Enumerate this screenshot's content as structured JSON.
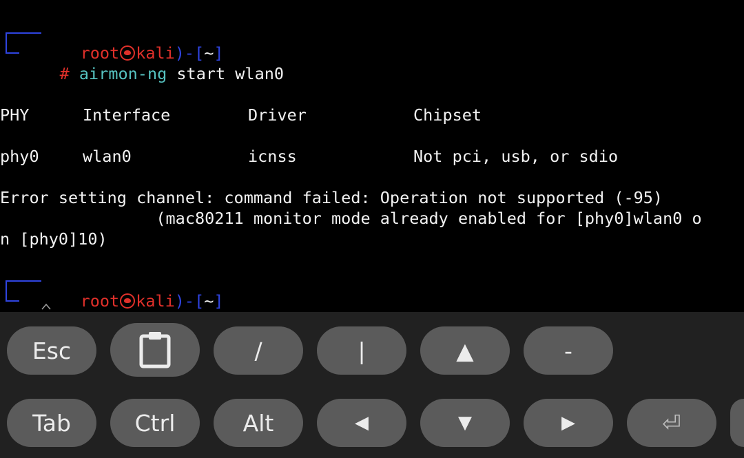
{
  "terminal": {
    "prompt1": {
      "user": "root",
      "host": "kali",
      "dir": "~",
      "hash": "#"
    },
    "command": {
      "program": "airmon-ng",
      "args": " start wlan0"
    },
    "table_headers": {
      "phy": "PHY",
      "interface": "Interface",
      "driver": "Driver",
      "chipset": "Chipset"
    },
    "row": {
      "phy": "phy0",
      "interface": "wlan0",
      "driver": "icnss",
      "chipset": "Not pci, usb, or sdio"
    },
    "error_line1": "Error setting channel: command failed: Operation not supported (-95)",
    "error_line2": "                (mac80211 monitor mode already enabled for [phy0]wlan0 o",
    "error_line3": "n [phy0]10)",
    "prompt2": {
      "user": "root",
      "host": "kali",
      "dir": "~",
      "hash": "#"
    }
  },
  "extra_keys": {
    "row1": [
      "Esc",
      "clipboard-icon",
      "/",
      "|",
      "▲",
      "-"
    ],
    "esc": "Esc",
    "slash": "/",
    "pipe": "|",
    "up": "▲",
    "minus": "-",
    "tab": "Tab",
    "ctrl": "Ctrl",
    "alt": "Alt",
    "left": "◀",
    "down": "▼",
    "right": "▶",
    "enter": "⏎"
  },
  "colors": {
    "prompt_red": "#e0302a",
    "prompt_blue": "#2f44e0",
    "command_cyan": "#56c2c0",
    "key_bg": "#5b5b5b",
    "keyboard_bg": "#212121"
  }
}
